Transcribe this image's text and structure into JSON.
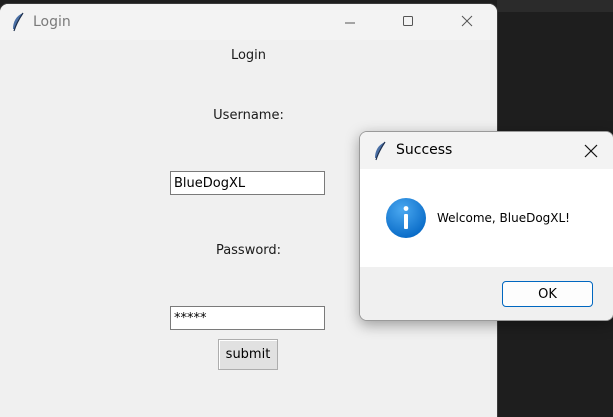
{
  "login_window": {
    "title": "Login",
    "heading": "Login",
    "username_label": "Username:",
    "username_value": "BlueDogXL",
    "password_label": "Password:",
    "password_value": "*****",
    "submit_label": "submit",
    "controls": [
      "minimize-icon",
      "maximize-icon",
      "close-icon"
    ]
  },
  "dialog": {
    "title": "Success",
    "message": "Welcome, BlueDogXL!",
    "icon": "info-icon",
    "ok_label": "OK"
  },
  "colors": {
    "window_bg": "#f0f0f0",
    "info_blue": "#0a74d4",
    "ok_border": "#0067c0"
  }
}
